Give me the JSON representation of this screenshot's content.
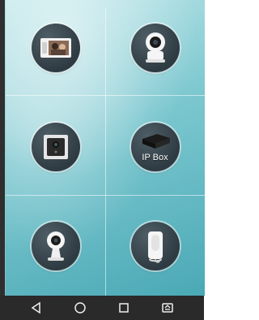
{
  "tiles": [
    {
      "name": "video-intercom-monitor",
      "icon": "video-door-phone-monitor-icon"
    },
    {
      "name": "pan-tilt-ip-camera",
      "icon": "pan-tilt-camera-icon"
    },
    {
      "name": "doorbell-camera",
      "icon": "doorbell-camera-icon"
    },
    {
      "name": "ip-box",
      "icon": "ip-box-icon",
      "label": "IP Box"
    },
    {
      "name": "indoor-camera",
      "icon": "indoor-dome-camera-icon"
    },
    {
      "name": "intercom-handset",
      "icon": "intercom-handset-icon"
    }
  ],
  "navbar": {
    "back": "back-icon",
    "home": "home-icon",
    "recents": "recents-icon",
    "rotate": "rotate-screen-icon"
  },
  "colors": {
    "background_top": "#bfe7ea",
    "background_bottom": "#4aa9b6",
    "circle": "#34424a",
    "navbar": "#2a2a2a"
  }
}
